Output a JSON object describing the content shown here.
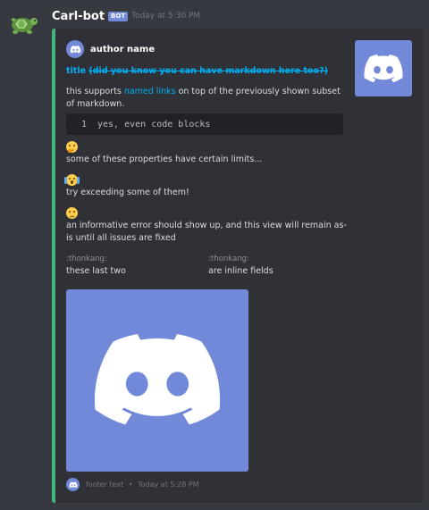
{
  "message": {
    "username": "Carl-bot",
    "badge": "BOT",
    "timestamp": "Today at 5:30 PM",
    "avatar_icon": "turtle-icon"
  },
  "embed": {
    "color": "#43b581",
    "author": {
      "name": "author name",
      "icon": "discord-logo-icon"
    },
    "thumbnail_icon": "discord-logo-icon",
    "title": {
      "plain": "title",
      "strike": "(did you know you can have markdown here too?)"
    },
    "description": {
      "before_link": "this supports ",
      "link": "named links",
      "after_link": " on top of the previously shown subset of markdown."
    },
    "code": {
      "line_number": "1",
      "text": "yes, even code blocks"
    },
    "lines": [
      {
        "emoji": "thinking-emoji",
        "text": "some of these properties have certain limits..."
      },
      {
        "emoji": "scream-emoji",
        "text": "try exceeding some of them!"
      },
      {
        "emoji": "confused-emoji",
        "text": "an informative error should show up, and this view will remain as-is until all issues are fixed"
      }
    ],
    "fields": [
      {
        "name": ":thonkang:",
        "value": "these last two"
      },
      {
        "name": ":thonkang:",
        "value": "are inline fields"
      }
    ],
    "image_icon": "discord-logo-icon",
    "footer": {
      "text": "footer text",
      "separator": "•",
      "timestamp": "Today at 5:28 PM"
    }
  }
}
